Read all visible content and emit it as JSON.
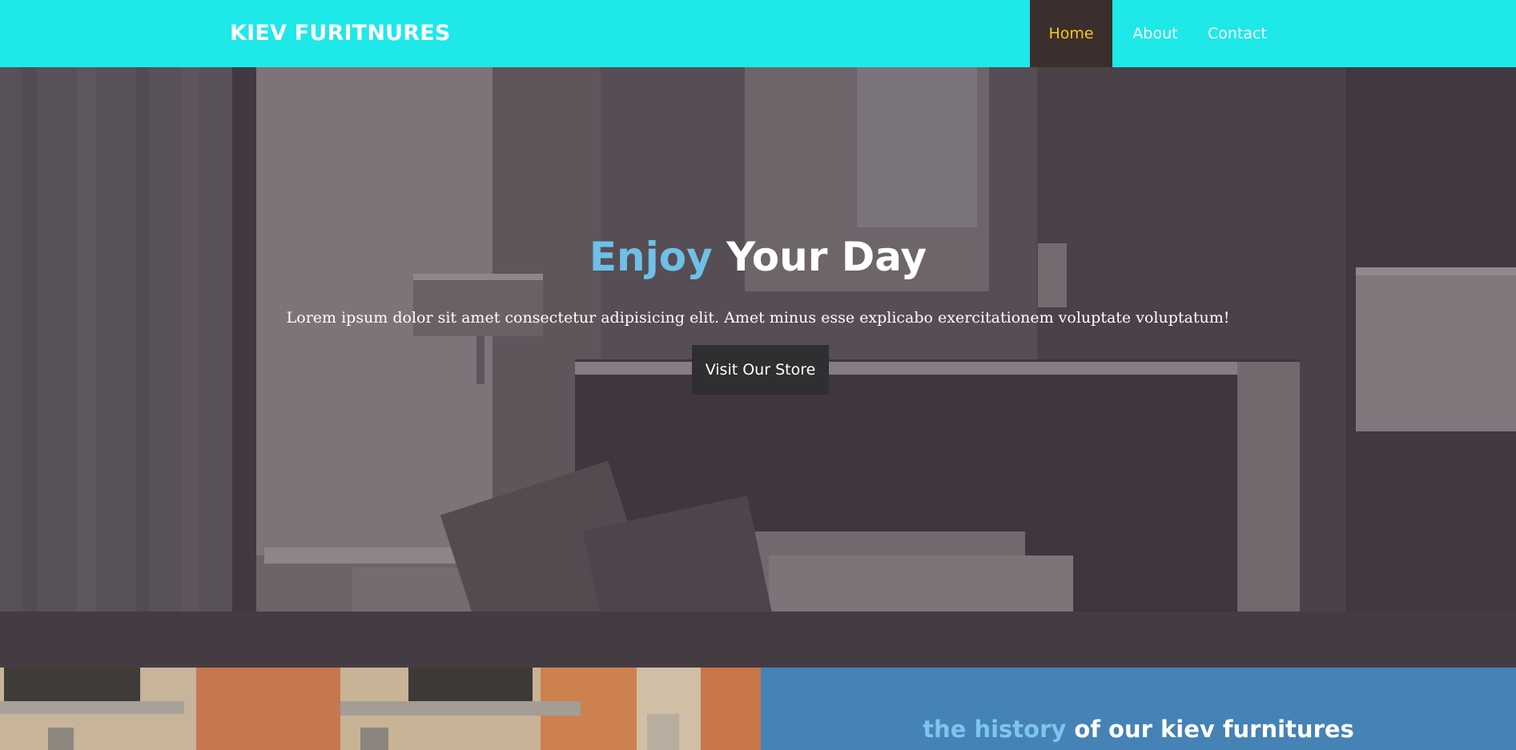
{
  "header": {
    "brand": "KIEV FURITNURES",
    "nav": [
      {
        "label": "Home"
      },
      {
        "label": "About"
      },
      {
        "label": "Contact"
      }
    ]
  },
  "hero": {
    "title_accent": "Enjoy",
    "title_rest": " Your Day",
    "subtitle": "Lorem ipsum dolor sit amet consectetur adipisicing elit. Amet minus esse explicabo exercitationem voluptate voluptatum!",
    "button_label": "Visit Our Store"
  },
  "history": {
    "title_accent": "the history",
    "title_rest": " of our kiev furnitures"
  },
  "colors": {
    "navbar": "#1fe8e9",
    "active_nav_bg": "#3a2f2d",
    "active_nav_text": "#f4c81e",
    "accent_blue": "#6ec0e6",
    "history_bg": "#4582b6"
  }
}
